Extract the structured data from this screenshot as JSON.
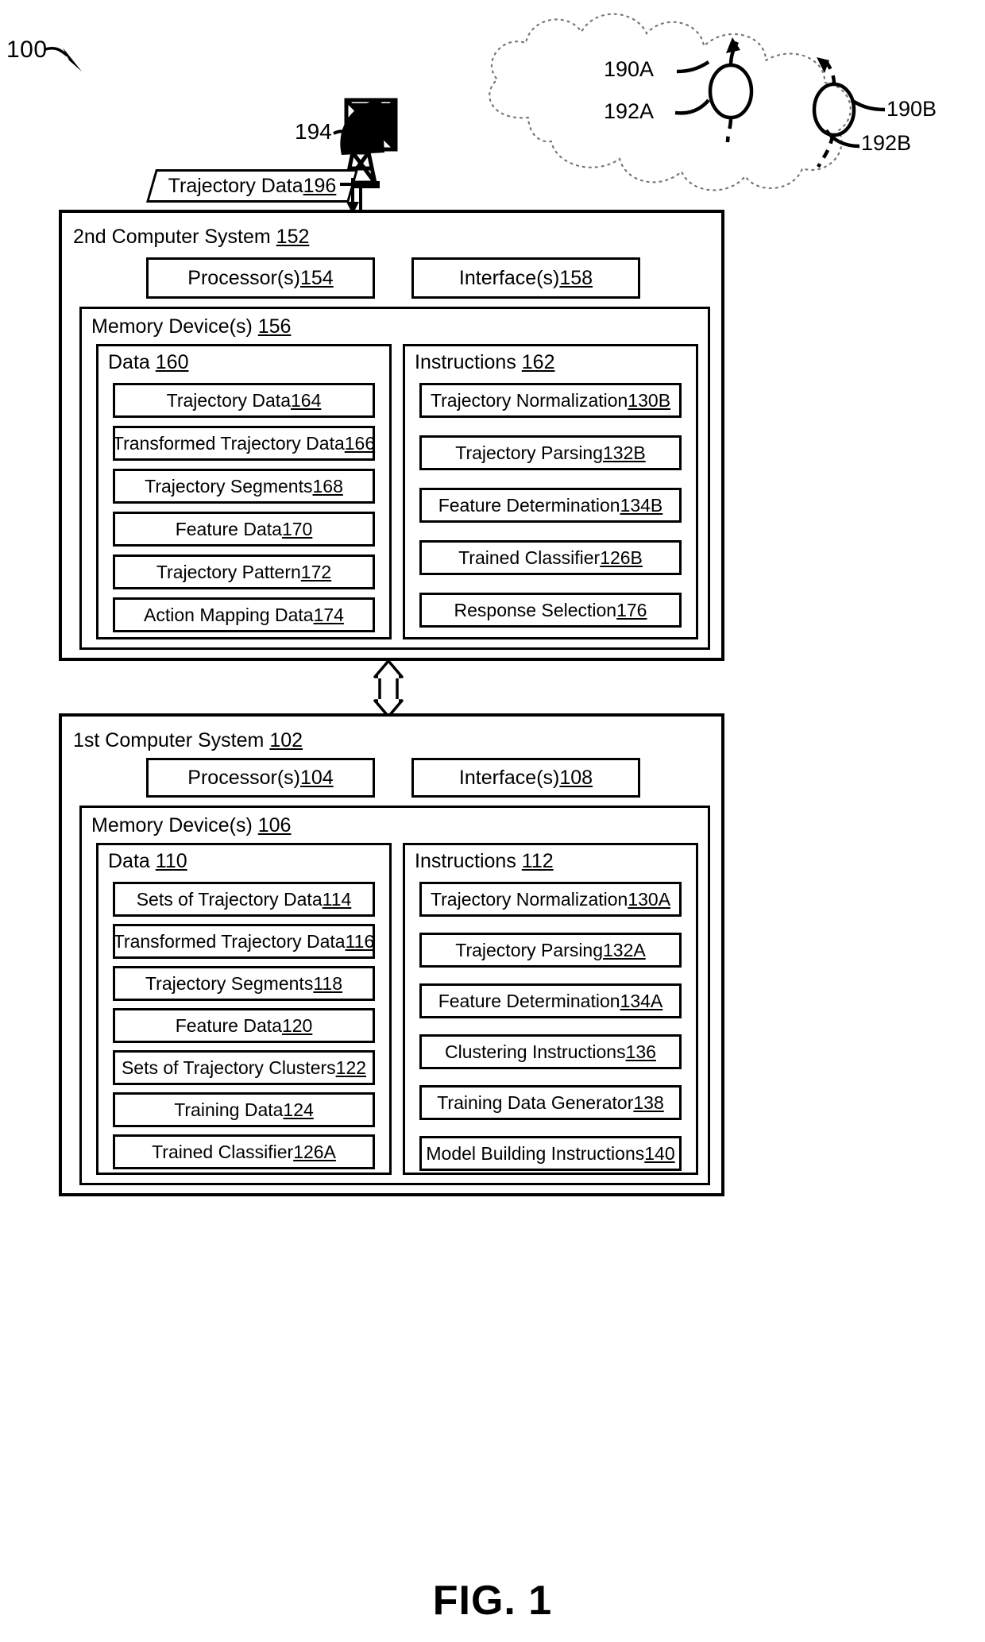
{
  "figure": {
    "caption": "FIG. 1",
    "system_ref": "100"
  },
  "cloud": {
    "aircraft_a_label": "190A",
    "track_a_label": "192A",
    "aircraft_b_label": "190B",
    "track_b_label": "192B"
  },
  "satellite": {
    "ref": "194"
  },
  "trajectory_data_flow": {
    "label": "Trajectory Data ",
    "ref": "196"
  },
  "second_system": {
    "title": "2nd Computer System ",
    "title_ref": "152",
    "processors": {
      "label": "Processor(s) ",
      "ref": "154"
    },
    "interfaces": {
      "label": "Interface(s) ",
      "ref": "158"
    },
    "memory": {
      "label": "Memory Device(s) ",
      "ref": "156"
    },
    "data_column": {
      "title": "Data ",
      "title_ref": "160",
      "items": [
        {
          "label": "Trajectory Data ",
          "ref": "164"
        },
        {
          "label": "Transformed Trajectory Data ",
          "ref": "166"
        },
        {
          "label": "Trajectory Segments ",
          "ref": "168"
        },
        {
          "label": "Feature Data ",
          "ref": "170"
        },
        {
          "label": "Trajectory Pattern ",
          "ref": "172"
        },
        {
          "label": "Action Mapping Data ",
          "ref": "174"
        }
      ]
    },
    "instructions_column": {
      "title": "Instructions ",
      "title_ref": "162",
      "items": [
        {
          "label": "Trajectory Normalization ",
          "ref": "130B"
        },
        {
          "label": "Trajectory Parsing ",
          "ref": "132B"
        },
        {
          "label": "Feature Determination ",
          "ref": "134B"
        },
        {
          "label": "Trained Classifier ",
          "ref": "126B"
        },
        {
          "label": "Response Selection ",
          "ref": "176"
        }
      ]
    }
  },
  "first_system": {
    "title": "1st Computer System ",
    "title_ref": "102",
    "processors": {
      "label": "Processor(s) ",
      "ref": "104"
    },
    "interfaces": {
      "label": "Interface(s) ",
      "ref": "108"
    },
    "memory": {
      "label": "Memory Device(s) ",
      "ref": "106"
    },
    "data_column": {
      "title": "Data ",
      "title_ref": "110",
      "items": [
        {
          "label": "Sets of Trajectory Data ",
          "ref": "114"
        },
        {
          "label": "Transformed Trajectory Data ",
          "ref": "116"
        },
        {
          "label": "Trajectory Segments ",
          "ref": "118"
        },
        {
          "label": "Feature Data ",
          "ref": "120"
        },
        {
          "label": "Sets of Trajectory Clusters ",
          "ref": "122"
        },
        {
          "label": "Training Data ",
          "ref": "124"
        },
        {
          "label": "Trained Classifier ",
          "ref": "126A"
        }
      ]
    },
    "instructions_column": {
      "title": "Instructions ",
      "title_ref": "112",
      "items": [
        {
          "label": "Trajectory Normalization ",
          "ref": "130A"
        },
        {
          "label": "Trajectory Parsing ",
          "ref": "132A"
        },
        {
          "label": "Feature Determination ",
          "ref": "134A"
        },
        {
          "label": "Clustering Instructions ",
          "ref": "136"
        },
        {
          "label": "Training Data Generator ",
          "ref": "138"
        },
        {
          "label": "Model Building Instructions ",
          "ref": "140"
        }
      ]
    }
  }
}
